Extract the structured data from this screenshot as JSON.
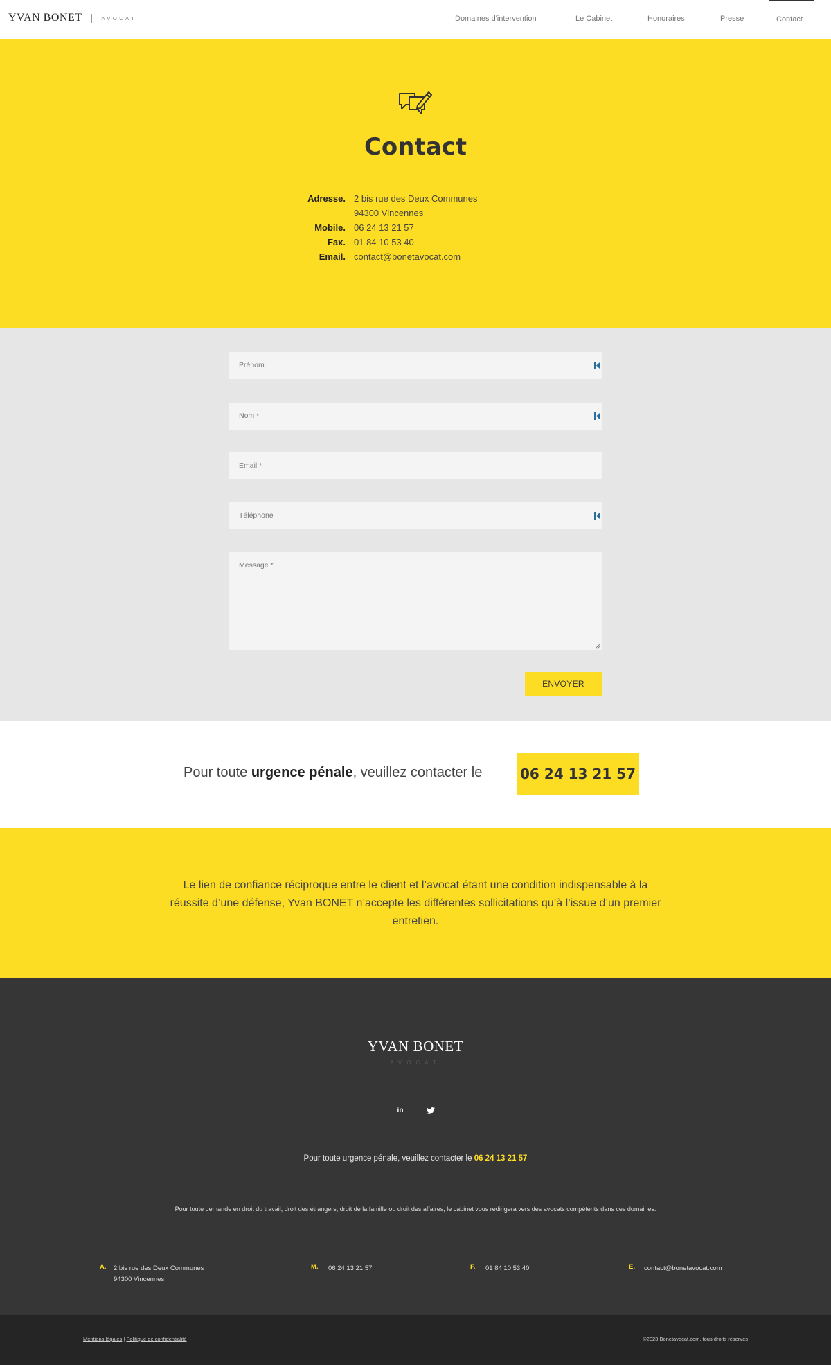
{
  "header": {
    "brand_name": "YVAN BONET",
    "brand_sub": "AVOCAT",
    "nav": [
      {
        "label": "Domaines d'intervention"
      },
      {
        "label": "Le Cabinet"
      },
      {
        "label": "Honoraires"
      },
      {
        "label": "Presse"
      },
      {
        "label": "Contact"
      }
    ],
    "active_nav": "Contact"
  },
  "hero": {
    "icon": "chat-pen-icon",
    "title": "Contact",
    "info": [
      {
        "label": "Adresse.",
        "value": "2 bis rue des Deux Communes"
      },
      {
        "label": "",
        "value": "94300 Vincennes"
      },
      {
        "label": "Mobile.",
        "value": "06 24 13 21 57"
      },
      {
        "label": "Fax.",
        "value": "01 84 10 53 40"
      },
      {
        "label": "Email.",
        "value": "contact@bonetavocat.com"
      }
    ]
  },
  "form": {
    "fields": [
      {
        "placeholder": "Prénom"
      },
      {
        "placeholder": "Nom *"
      },
      {
        "placeholder": "Email *"
      },
      {
        "placeholder": "Téléphone"
      }
    ],
    "message_placeholder": "Message *",
    "submit_label": "ENVOYER"
  },
  "urgence": {
    "prefix": "Pour toute ",
    "bold": "urgence pénale",
    "suffix": ", veuillez contacter le",
    "phone": "06 24 13 21 57"
  },
  "quote": {
    "text": "Le lien de confiance réciproque entre le client et l’avocat étant une condition indispensable à la réussite d’une défense, Yvan BONET n’accepte les différentes sollicitations qu’à l’issue d’un premier entretien."
  },
  "footer": {
    "brand_name": "YVAN BONET",
    "brand_sub": "AVOCAT",
    "social": [
      "linkedin-icon",
      "twitter-icon"
    ],
    "urgence_text": "Pour toute urgence pénale, veuillez contacter le ",
    "urgence_phone": "06 24 13 21 57",
    "note": "Pour toute demande en droit du travail, droit des étrangers, droit de la famille ou droit des affaires, le cabinet vous redirigera vers des avocats compétents dans ces domaines.",
    "contacts": [
      {
        "key": "A.",
        "line1": "2 bis rue des Deux Communes",
        "line2": "94300 Vincennes"
      },
      {
        "key": "M.",
        "line1": "06 24 13 21 57",
        "line2": ""
      },
      {
        "key": "F.",
        "line1": "01 84 10 53 40",
        "line2": ""
      },
      {
        "key": "E.",
        "line1": "contact@bonetavocat.com",
        "line2": ""
      }
    ]
  },
  "bottom": {
    "legal_link": "Mentions légales",
    "separator": " | ",
    "privacy_link": "Politique de confidentialité",
    "copyright": "©2023 Bonetavocat.com, tous droits réservés"
  },
  "colors": {
    "accent": "#fddd24",
    "footer_bg": "#363636",
    "bottom_bg": "#252525",
    "form_bg": "#e6e6e6"
  }
}
